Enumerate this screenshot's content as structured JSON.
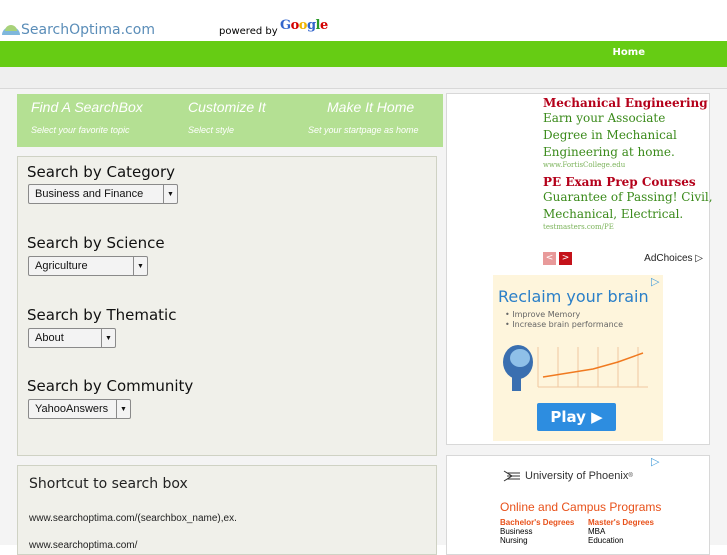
{
  "header": {
    "site_name": "SearchOptima.com",
    "powered_by": "powered by",
    "google_letters": [
      {
        "ch": "G",
        "color": "#3366cc"
      },
      {
        "ch": "o",
        "color": "#d40000"
      },
      {
        "ch": "o",
        "color": "#f0b400"
      },
      {
        "ch": "g",
        "color": "#3366cc"
      },
      {
        "ch": "l",
        "color": "#2a9a2a"
      },
      {
        "ch": "e",
        "color": "#d40000"
      }
    ],
    "accent_color": "#66cc14"
  },
  "nav": {
    "home": "Home"
  },
  "steps": [
    {
      "title": "Find A SearchBox",
      "subtitle": "Select your favorite topic"
    },
    {
      "title": "Customize It",
      "subtitle": "Select style"
    },
    {
      "title": "Make It Home",
      "subtitle": "Set your startpage as home"
    }
  ],
  "categories": [
    {
      "heading": "Search by Category",
      "selected": "Business and Finance"
    },
    {
      "heading": "Search by Science",
      "selected": "Agriculture"
    },
    {
      "heading": "Search by Thematic",
      "selected": "About"
    },
    {
      "heading": "Search by Community",
      "selected": "YahooAnswers"
    }
  ],
  "shortcut": {
    "title": "Shortcut to search box",
    "url": "www.searchoptima.com/(searchbox_name),ex.",
    "more": "www.searchoptima.com/"
  },
  "ad1": {
    "items": [
      {
        "title": "Mechanical Engineering",
        "body": "Earn your Associate Degree in Mechanical Engineering at home.",
        "url": "www.FortisCollege.edu"
      },
      {
        "title": "PE Exam Prep Courses",
        "body": "Guarantee of Passing! Civil, Mechanical, Electrical.",
        "url": "testmasters.com/PE"
      }
    ],
    "adchoices": "AdChoices",
    "prev": "<",
    "next": ">"
  },
  "ad2": {
    "title": "Reclaim your brain",
    "bullets": [
      "• Improve Memory",
      "• Increase brain performance"
    ],
    "play": "Play ▶"
  },
  "ad3": {
    "logo": "University of Phoenix",
    "headline": "Online and Campus Programs",
    "col1": {
      "heading": "Bachelor's Degrees",
      "items": [
        "Business",
        "Nursing"
      ]
    },
    "col2": {
      "heading": "Master's Degrees",
      "items": [
        "MBA",
        "Education"
      ]
    }
  }
}
